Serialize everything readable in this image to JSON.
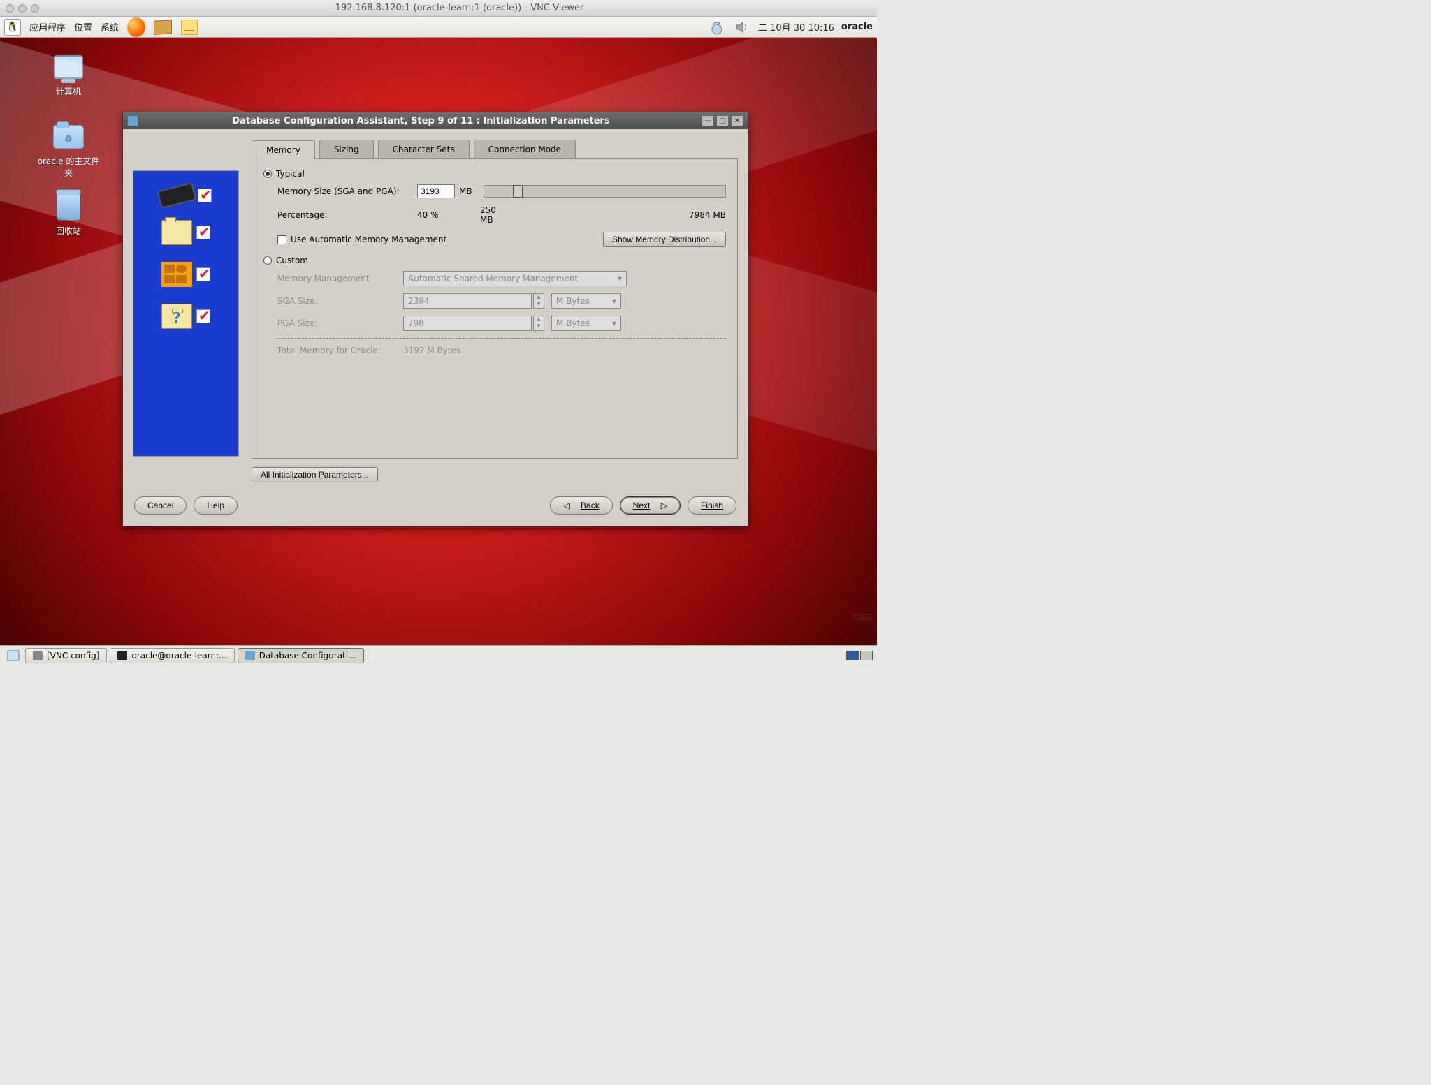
{
  "mac_titlebar": {
    "title": "192.168.8.120:1 (oracle-learn:1 (oracle)) - VNC Viewer"
  },
  "gnome_panel": {
    "apps": "应用程序",
    "places": "位置",
    "system": "系统",
    "clock": "二  10月  30 10:16",
    "user": "oracle"
  },
  "desktop_icons": {
    "computer": "计算机",
    "home": "oracle 的主文件夹",
    "trash": "回收站"
  },
  "dialog": {
    "title": "Database Configuration Assistant, Step 9 of 11 : Initialization Parameters",
    "tabs": {
      "memory": "Memory",
      "sizing": "Sizing",
      "charsets": "Character Sets",
      "connmode": "Connection Mode"
    },
    "typical": {
      "label": "Typical",
      "memsize_label": "Memory Size (SGA and PGA):",
      "memsize_value": "3193",
      "memsize_unit": "MB",
      "percentage_label": "Percentage:",
      "percentage_value": "40 %",
      "slider_min": "250 MB",
      "slider_max": "7984 MB",
      "auto_mem_label": "Use Automatic Memory Management",
      "show_dist": "Show Memory Distribution..."
    },
    "custom": {
      "label": "Custom",
      "mem_mgmt_label": "Memory Management",
      "mem_mgmt_value": "Automatic Shared Memory Management",
      "sga_label": "SGA Size:",
      "sga_value": "2394",
      "pga_label": "PGA Size:",
      "pga_value": "798",
      "unit": "M Bytes",
      "total_label": "Total Memory for Oracle:",
      "total_value": "3192 M Bytes"
    },
    "all_params": "All Initialization Parameters...",
    "footer": {
      "cancel": "Cancel",
      "help": "Help",
      "back": "Back",
      "next": "Next",
      "finish": "Finish"
    }
  },
  "taskbar": {
    "vnc": "[VNC config]",
    "term": "oracle@oracle-learn:...",
    "dbca": "Database Configurati..."
  },
  "watermark": "亿速云"
}
